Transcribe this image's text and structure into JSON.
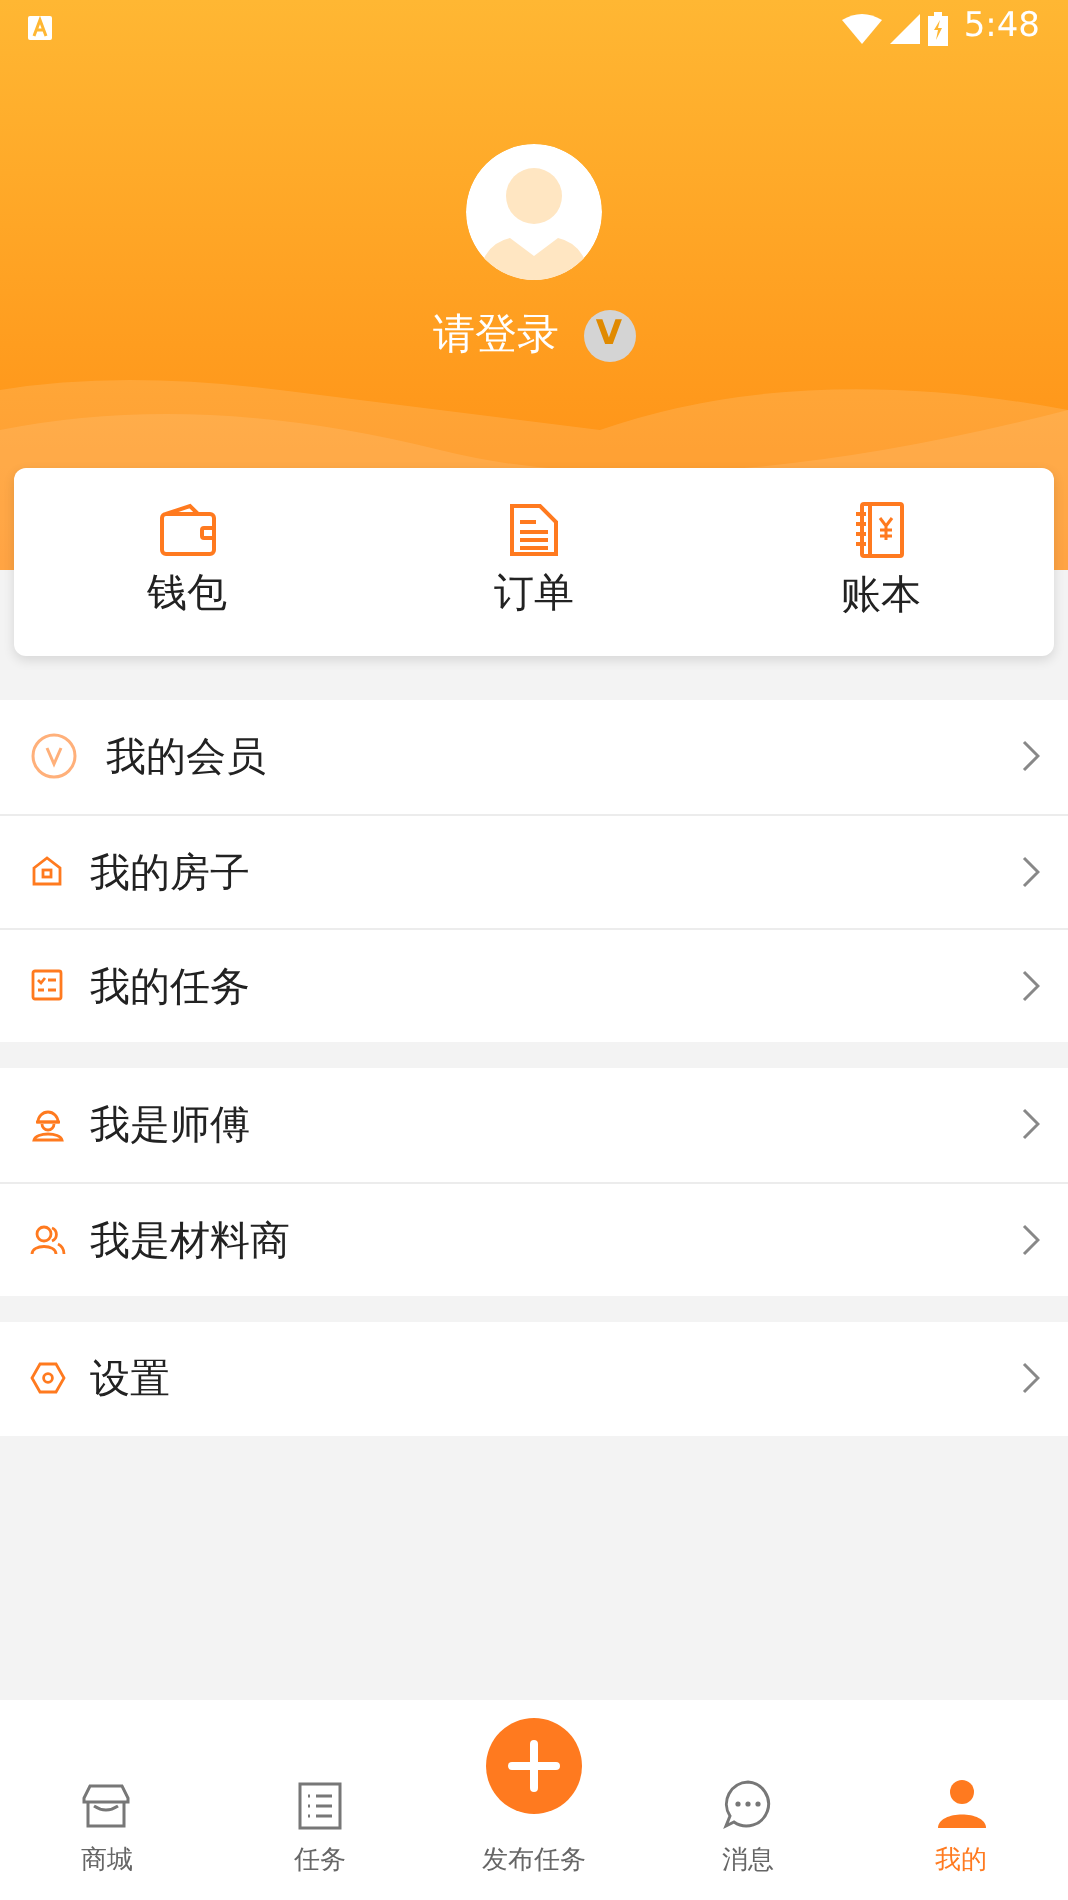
{
  "status_bar": {
    "time": "5:48"
  },
  "profile": {
    "name": "请登录",
    "badge": "V"
  },
  "shortcuts": [
    {
      "label": "钱包"
    },
    {
      "label": "订单"
    },
    {
      "label": "账本"
    }
  ],
  "menu_groups": [
    {
      "items": [
        {
          "label": "我的会员"
        },
        {
          "label": "我的房子"
        },
        {
          "label": "我的任务"
        }
      ]
    },
    {
      "items": [
        {
          "label": "我是师傅"
        },
        {
          "label": "我是材料商"
        }
      ]
    },
    {
      "items": [
        {
          "label": "设置"
        }
      ]
    }
  ],
  "bottom_nav": [
    {
      "label": "商城",
      "kind": "tab",
      "selected": false
    },
    {
      "label": "任务",
      "kind": "tab",
      "selected": false
    },
    {
      "label": "发布任务",
      "kind": "publish",
      "selected": false
    },
    {
      "label": "消息",
      "kind": "tab",
      "selected": false
    },
    {
      "label": "我的",
      "kind": "tab",
      "selected": true
    }
  ]
}
